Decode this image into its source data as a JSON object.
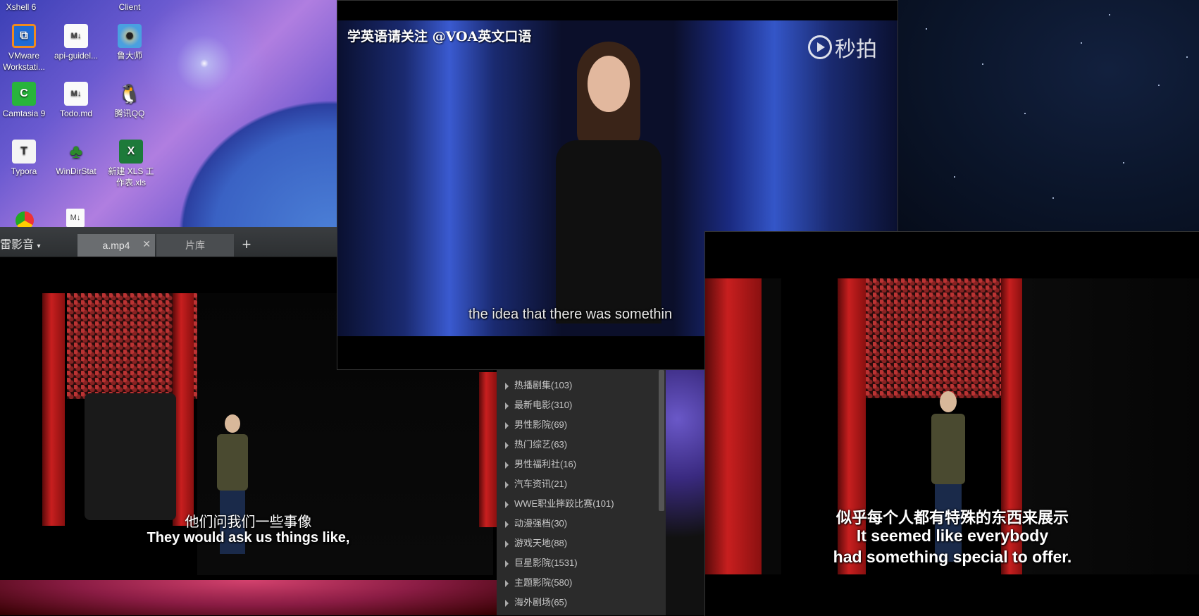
{
  "desktop": {
    "icons": [
      {
        "label": "Xshell 6",
        "glyph": "terminal-icon"
      },
      {
        "label": "Client",
        "glyph": "app-icon"
      },
      {
        "label": "VMware Workstati...",
        "glyph": "vmware-icon"
      },
      {
        "label": "api-guidel...",
        "glyph": "markdown-icon"
      },
      {
        "label": "鲁大师",
        "glyph": "robot-icon"
      },
      {
        "label": "Camtasia 9",
        "glyph": "camtasia-icon"
      },
      {
        "label": "Todo.md",
        "glyph": "markdown-icon"
      },
      {
        "label": "腾讯QQ",
        "glyph": "penguin-icon"
      },
      {
        "label": "Typora",
        "glyph": "typora-icon"
      },
      {
        "label": "WinDirStat",
        "glyph": "tree-icon"
      },
      {
        "label": "新建 XLS 工作表.xls",
        "glyph": "excel-icon"
      }
    ]
  },
  "player": {
    "brand": "雷影音",
    "tabs": [
      {
        "label": "a.mp4"
      },
      {
        "label": "片库"
      }
    ],
    "subtitle_zh": "他们问我们一些事像",
    "subtitle_en": "They would ask us things like,"
  },
  "center_video": {
    "watermark_left": "学英语请关注 @VOA英文口语",
    "watermark_right": "秒拍",
    "subtitle": "the idea that there was somethin"
  },
  "right_video": {
    "subtitle_zh": "似乎每个人都有特殊的东西来展示",
    "subtitle_en_1": "It seemed like everybody",
    "subtitle_en_2": "had something special to offer."
  },
  "playlist": {
    "items": [
      "热播剧集(103)",
      "最新电影(310)",
      "男性影院(69)",
      "热门综艺(63)",
      "男性福利社(16)",
      "汽车资讯(21)",
      "WWE职业摔跤比赛(101)",
      "动漫强档(30)",
      "游戏天地(88)",
      "巨星影院(1531)",
      "主题影院(580)",
      "海外剧场(65)"
    ]
  }
}
